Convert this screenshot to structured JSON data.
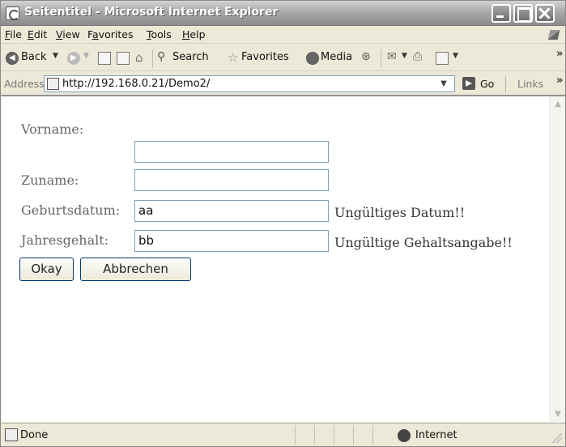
{
  "window": {
    "title": "Seitentitel - Microsoft Internet Explorer"
  },
  "menu": {
    "items": [
      {
        "underline": "F",
        "rest": "ile"
      },
      {
        "underline": "E",
        "rest": "dit"
      },
      {
        "underline": "V",
        "rest": "iew"
      },
      {
        "pre": "F",
        "underline": "a",
        "rest": "vorites"
      },
      {
        "underline": "T",
        "rest": "ools"
      },
      {
        "underline": "H",
        "rest": "elp"
      }
    ]
  },
  "toolbar": {
    "back_label": "Back",
    "search_label": "Search",
    "favorites_label": "Favorites",
    "media_label": "Media"
  },
  "address": {
    "label": "Address",
    "value": "http://192.168.0.21/Demo2/",
    "go_label": "Go",
    "links_label": "Links"
  },
  "form": {
    "fields": [
      {
        "label": "Vorname:",
        "value": "",
        "error": ""
      },
      {
        "label": "Zuname:",
        "value": "",
        "error": ""
      },
      {
        "label": "Geburtsdatum:",
        "value": "aa",
        "error": "Ungültiges Datum!!"
      },
      {
        "label": "Jahresgehalt:",
        "value": "bb",
        "error": "Ungültige Gehaltsangabe!!"
      }
    ],
    "okay_label": "Okay",
    "cancel_label": "Abbrechen"
  },
  "status": {
    "text": "Done",
    "zone": "Internet"
  },
  "icons": [
    "ie-page-icon",
    "back-arrow-icon",
    "forward-arrow-icon",
    "stop-icon",
    "refresh-icon",
    "home-icon",
    "search-icon",
    "favorites-star-icon",
    "media-icon",
    "history-icon",
    "mail-icon",
    "print-icon",
    "edit-icon",
    "go-arrow-icon",
    "globe-icon"
  ]
}
